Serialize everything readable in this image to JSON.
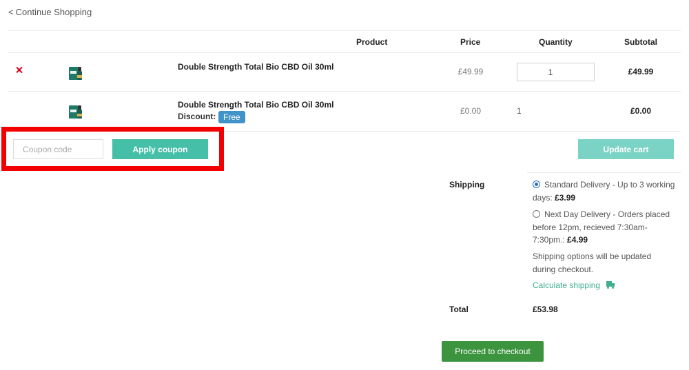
{
  "nav": {
    "continue_label": "Continue Shopping",
    "continue_prefix": "<"
  },
  "table": {
    "headers": {
      "product": "Product",
      "price": "Price",
      "quantity": "Quantity",
      "subtotal": "Subtotal"
    },
    "rows": [
      {
        "name": "Double Strength Total Bio CBD Oil 30ml",
        "price": "£49.99",
        "quantity": "1",
        "subtotal": "£49.99",
        "removable": true
      },
      {
        "name": "Double Strength Total Bio CBD Oil 30ml",
        "discount_label": "Discount:",
        "discount_badge": "Free",
        "price": "£0.00",
        "quantity": "1",
        "subtotal": "£0.00",
        "removable": false
      }
    ]
  },
  "coupon": {
    "placeholder": "Coupon code",
    "apply_label": "Apply coupon",
    "highlight_color": "#f20000"
  },
  "update_label": "Update cart",
  "totals": {
    "shipping_label": "Shipping",
    "options": [
      {
        "text": "Standard Delivery - Up to 3 working days:",
        "price": "£3.99",
        "selected": true
      },
      {
        "text": "Next Day Delivery - Orders placed before 12pm, recieved 7:30am-7:30pm.:",
        "price": "£4.99",
        "selected": false
      }
    ],
    "note": "Shipping options will be updated during checkout.",
    "calc_label": "Calculate shipping",
    "calc_icon": "truck-icon",
    "total_label": "Total",
    "total_value": "£53.98"
  },
  "checkout_label": "Proceed to checkout",
  "colors": {
    "accent": "#45bfa8",
    "checkout": "#3c943e",
    "badge": "#3f93c9",
    "remove": "#d0021b"
  }
}
